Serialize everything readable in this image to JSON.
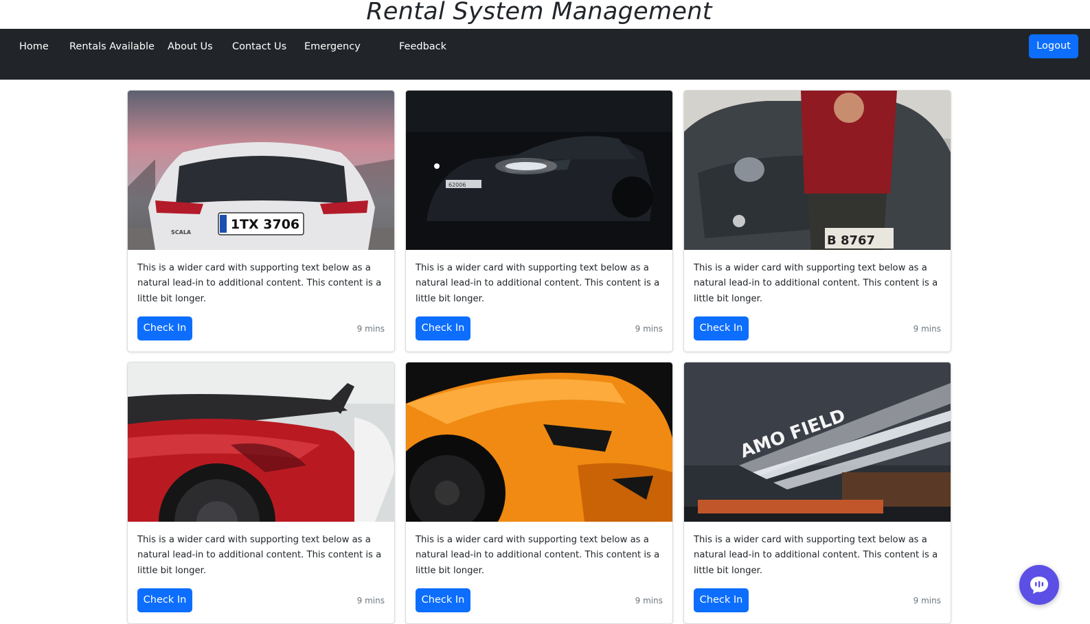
{
  "header": {
    "title": "Rental System Management"
  },
  "nav": {
    "items": [
      {
        "label": "Home"
      },
      {
        "label": "Rentals Available"
      },
      {
        "label": "About Us"
      },
      {
        "label": "Contact Us"
      },
      {
        "label": "Emergency"
      },
      {
        "label": "Feedback"
      }
    ],
    "logout_label": "Logout"
  },
  "cards": [
    {
      "image": "white-hatchback-rear-photo",
      "plate": "1TX 3706",
      "badge": "SCALA",
      "text": "This is a wider card with supporting text below as a natural lead-in to additional content. This content is a little bit longer.",
      "button_label": "Check In",
      "time": "9 mins"
    },
    {
      "image": "dark-sedan-night-photo",
      "plate": "62006",
      "text": "This is a wider card with supporting text below as a natural lead-in to additional content. This content is a little bit longer.",
      "button_label": "Check In",
      "time": "9 mins"
    },
    {
      "image": "man-red-shirt-suv-photo",
      "plate": "B 8767",
      "text": "This is a wider card with supporting text below as a natural lead-in to additional content. This content is a little bit longer.",
      "button_label": "Check In",
      "time": "9 mins"
    },
    {
      "image": "red-sports-car-wing-photo",
      "text": "This is a wider card with supporting text below as a natural lead-in to additional content. This content is a little bit longer.",
      "button_label": "Check In",
      "time": "9 mins"
    },
    {
      "image": "orange-supercar-front-photo",
      "text": "This is a wider card with supporting text below as a natural lead-in to additional content. This content is a little bit longer.",
      "button_label": "Check In",
      "time": "9 mins"
    },
    {
      "image": "building-sign-night-photo",
      "sign": "AMO FIELD",
      "text": "This is a wider card with supporting text below as a natural lead-in to additional content. This content is a little bit longer.",
      "button_label": "Check In",
      "time": "9 mins"
    }
  ],
  "chat": {
    "icon": "chat-bubble-icon"
  },
  "colors": {
    "primary": "#0d6efd",
    "navbar": "#212529",
    "chat": "#5b4fe6"
  }
}
